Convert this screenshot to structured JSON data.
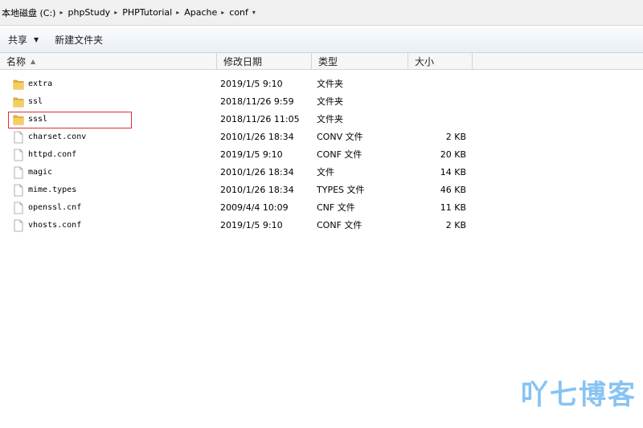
{
  "address": {
    "crumbs": [
      "本地磁盘 (C:)",
      "phpStudy",
      "PHPTutorial",
      "Apache",
      "conf"
    ]
  },
  "toolbar": {
    "share_label": "共享",
    "new_folder_label": "新建文件夹"
  },
  "columns": {
    "name": "名称",
    "date": "修改日期",
    "type": "类型",
    "size": "大小"
  },
  "files": [
    {
      "name": "extra",
      "date": "2019/1/5 9:10",
      "type": "文件夹",
      "size": "",
      "kind": "folder"
    },
    {
      "name": "ssl",
      "date": "2018/11/26 9:59",
      "type": "文件夹",
      "size": "",
      "kind": "folder"
    },
    {
      "name": "sssl",
      "date": "2018/11/26 11:05",
      "type": "文件夹",
      "size": "",
      "kind": "folder"
    },
    {
      "name": "charset.conv",
      "date": "2010/1/26 18:34",
      "type": "CONV 文件",
      "size": "2 KB",
      "kind": "file"
    },
    {
      "name": "httpd.conf",
      "date": "2019/1/5 9:10",
      "type": "CONF 文件",
      "size": "20 KB",
      "kind": "file"
    },
    {
      "name": "magic",
      "date": "2010/1/26 18:34",
      "type": "文件",
      "size": "14 KB",
      "kind": "file"
    },
    {
      "name": "mime.types",
      "date": "2010/1/26 18:34",
      "type": "TYPES 文件",
      "size": "46 KB",
      "kind": "file"
    },
    {
      "name": "openssl.cnf",
      "date": "2009/4/4 10:09",
      "type": "CNF 文件",
      "size": "11 KB",
      "kind": "file"
    },
    {
      "name": "vhosts.conf",
      "date": "2019/1/5 9:10",
      "type": "CONF 文件",
      "size": "2 KB",
      "kind": "file"
    }
  ],
  "watermark": "吖七博客",
  "colors": {
    "highlight_border": "#d9303a",
    "folder_yellow": "#e8b53a",
    "watermark": "#5fb0ef"
  }
}
